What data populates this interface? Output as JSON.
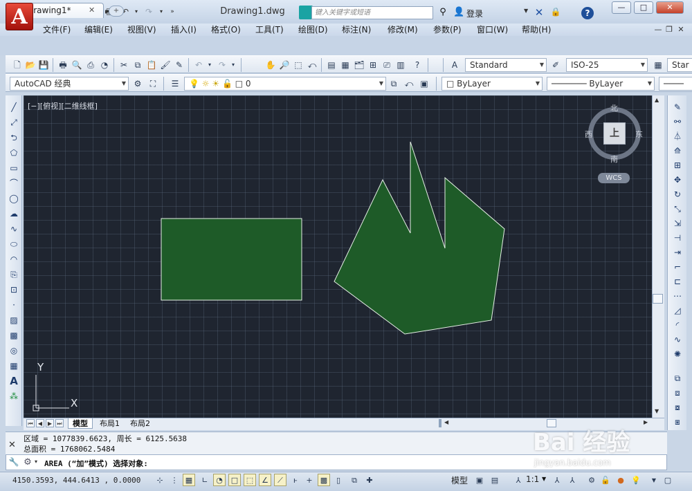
{
  "app": {
    "logo_letter": "A",
    "document_title": "Drawing1.dwg",
    "search_placeholder": "键入关键字或短语",
    "login_label": "登录",
    "window_buttons": [
      "—",
      "□",
      "✕"
    ]
  },
  "menu": {
    "items": [
      "文件(F)",
      "编辑(E)",
      "视图(V)",
      "插入(I)",
      "格式(O)",
      "工具(T)",
      "绘图(D)",
      "标注(N)",
      "修改(M)",
      "参数(P)",
      "窗口(W)",
      "帮助(H)"
    ]
  },
  "doc_tabs": {
    "active": "Drawing1*",
    "close_glyph": "✕",
    "new_glyph": "+"
  },
  "toolbar1": {
    "text_style": "Standard",
    "dim_style": "ISO-25",
    "table_style": "Star"
  },
  "toolbar2": {
    "workspace": "AutoCAD 经典",
    "layer": "0",
    "color": "ByLayer",
    "linetype": "ByLayer"
  },
  "viewport": {
    "label": "[−][俯视][二维线框]",
    "compass": {
      "north": "北",
      "south": "南",
      "east": "东",
      "west": "西",
      "top_face": "上"
    },
    "wcs": "WCS",
    "ucs_x": "X",
    "ucs_y": "Y",
    "fill_color": "#1e5b28",
    "edge_color": "#e6f0e6"
  },
  "layout_tabs": {
    "model": "模型",
    "layout1": "布局1",
    "layout2": "布局2"
  },
  "command": {
    "history": [
      "区域 = 1077839.6623, 周长 = 6125.5638",
      "总面积 = 1768062.5484"
    ],
    "prompt": "AREA (“加”模式) 选择对象:"
  },
  "status": {
    "coordinates": "4150.3593, 444.6413 , 0.0000",
    "model": "模型",
    "scale": "1:1"
  },
  "watermark": {
    "brand": "Bai 经验",
    "url": "jingyan.baidu.com"
  }
}
